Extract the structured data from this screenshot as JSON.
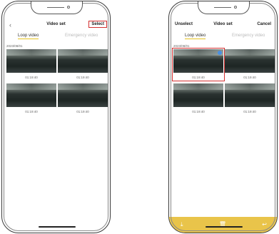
{
  "left_screen": {
    "nav": {
      "title": "Video set",
      "back_icon": "‹",
      "select_label": "Select"
    },
    "tabs": [
      {
        "label": "Loop video"
      },
      {
        "label": "Emergency video"
      }
    ],
    "date_group": "2023/08/01",
    "videos": [
      {
        "time": "01:19:40"
      },
      {
        "time": "01:19:40"
      },
      {
        "time": "01:19:40"
      },
      {
        "time": "01:19:40"
      }
    ]
  },
  "right_screen": {
    "nav": {
      "unselect_label": "Unselect",
      "title": "Video set",
      "cancel_label": "Cancel"
    },
    "tabs": [
      {
        "label": "Loop video"
      },
      {
        "label": "Emergency video"
      }
    ],
    "date_group": "2023/08/01",
    "videos": [
      {
        "time": "01:19:40",
        "selected": true
      },
      {
        "time": "01:19:40",
        "selected": false
      },
      {
        "time": "01:19:40",
        "selected": false
      },
      {
        "time": "01:19:40",
        "selected": false
      }
    ],
    "toolbar": {
      "download_icon": "⤓",
      "delete_icon": "🗑",
      "back_icon": "↩"
    }
  },
  "colors": {
    "accent_yellow": "#e6c21e",
    "toolbar_bg": "#e9c44a",
    "highlight_red": "#d32f2f",
    "check_blue": "#4a90e2"
  }
}
